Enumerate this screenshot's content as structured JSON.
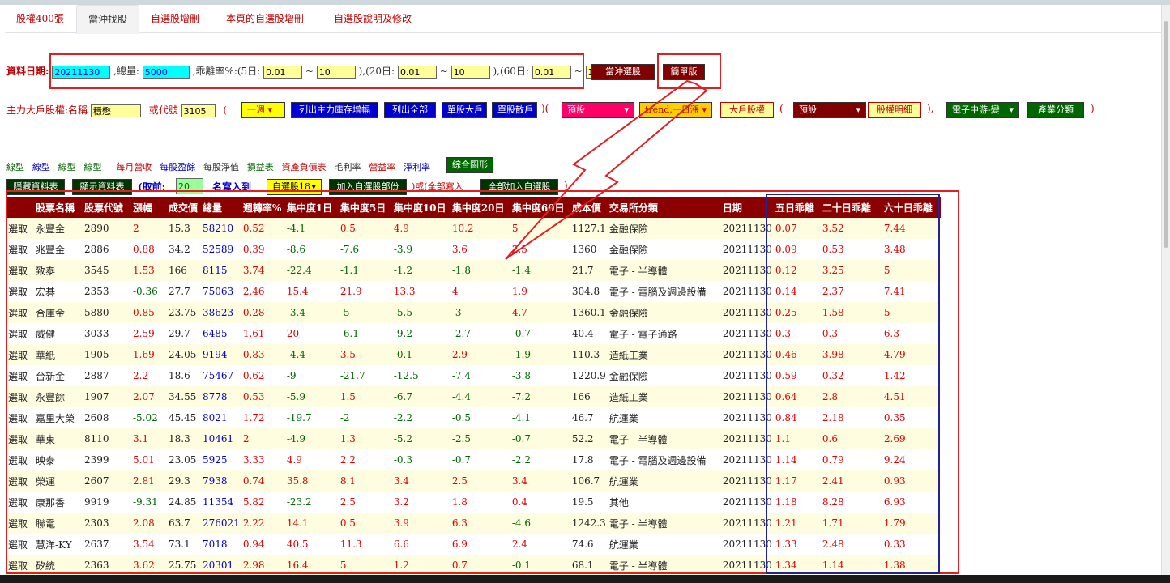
{
  "tabs": [
    "股權400張",
    "當沖找股",
    "自選股增刪",
    "本頁的自選股增刪",
    "自選股說明及修改"
  ],
  "active_tab": 1,
  "row1": {
    "date_label": "資料日期:",
    "date_value": "20211130",
    "total_label": ",總量:",
    "total_value": "5000",
    "dev_label": ",乖離率%:(5日:",
    "d5_min": "0.01",
    "d5_max": "10",
    "d20_label": "),(20日:",
    "d20_min": "0.01",
    "d20_max": "10",
    "d60_label": "),(60日:",
    "d60_min": "0.01",
    "d60_max": "10",
    "close": ")",
    "tilde": "~",
    "daytrade_btn": "當沖選股",
    "simple_btn": "簡單版"
  },
  "row2": {
    "label": "主力大戶股權:名稱",
    "name_value": "穩懋",
    "or_code": "或代號",
    "code_value": "3105",
    "paren_open": "(",
    "period_sel": "一週",
    "btn_list_stock": "列出主力庫存增幅",
    "btn_list_all": "列出全部",
    "btn_single_big": "單股大戶",
    "btn_single_scatter": "單股散戶",
    "paren_mid": ")(",
    "preset_sel": "預設",
    "trend_sel": "trend.一日漲",
    "btn_big_equity": "大戶股權",
    "paren_mid2": "(",
    "preset_sel2": "預設",
    "btn_equity_detail": "股權明細",
    "paren_close": "),",
    "industry_sel": "電子中游-變",
    "btn_industry": "產業分類",
    "paren_end": ")"
  },
  "links": {
    "items": [
      {
        "text": "線型",
        "color": "#006600"
      },
      {
        "text": "線型",
        "color": "#0000cc"
      },
      {
        "text": "線型",
        "color": "#006600"
      },
      {
        "text": "線型",
        "color": "#006600"
      },
      {
        "text": "每月營收",
        "color": "#c00000"
      },
      {
        "text": "每股盈餘",
        "color": "#0000cc"
      },
      {
        "text": "每股淨值",
        "color": "#333333"
      },
      {
        "text": "損益表",
        "color": "#006600"
      },
      {
        "text": "資產負債表",
        "color": "#c00000"
      },
      {
        "text": "毛利率",
        "color": "#333333"
      },
      {
        "text": "營益率",
        "color": "#c00000"
      },
      {
        "text": "淨利率",
        "color": "#0000cc"
      }
    ],
    "combo_btn": "綜合圖形"
  },
  "row4": {
    "hide_btn": "隱藏資料表",
    "show_btn": "顯示資料表",
    "take_label": "(取前:",
    "take_value": "20",
    "write_to": "名寫入到",
    "watchlist_sel": "自選股18",
    "add_part_btn": "加入自選股部份",
    "or_all": ")或(全部寫入",
    "add_all_btn": "全部加入自選股",
    "close": ")"
  },
  "table": {
    "headers": [
      "",
      "股票名稱",
      "股票代號",
      "漲幅",
      "成交價",
      "總量",
      "週轉率%",
      "集中度1日",
      "集中度5日",
      "集中度10日",
      "集中度20日",
      "集中度60日",
      "成本價",
      "交易所分類",
      "日期",
      "五日乖離",
      "二十日乖離",
      "六十日乖離"
    ],
    "select_label": "選取",
    "rows": [
      [
        "永豐金",
        "2890",
        "2",
        "15.3",
        "58210",
        "0.52",
        "-4.1",
        "0.5",
        "4.9",
        "10.2",
        "5",
        "1127.1",
        "金融保險",
        "20211130",
        "0.07",
        "3.52",
        "7.44"
      ],
      [
        "兆豐金",
        "2886",
        "0.88",
        "34.2",
        "52589",
        "0.39",
        "-8.6",
        "-7.6",
        "-3.9",
        "3.6",
        "2.5",
        "1360",
        "金融保險",
        "20211130",
        "0.09",
        "0.53",
        "3.48"
      ],
      [
        "致泰",
        "3545",
        "1.53",
        "166",
        "8115",
        "3.74",
        "-22.4",
        "-1.1",
        "-1.2",
        "-1.8",
        "-1.4",
        "21.7",
        "電子 - 半導體",
        "20211130",
        "0.12",
        "3.25",
        "5"
      ],
      [
        "宏碁",
        "2353",
        "-0.36",
        "27.7",
        "75063",
        "2.46",
        "15.4",
        "21.9",
        "13.3",
        "4",
        "1.9",
        "304.8",
        "電子 - 電腦及週邊設備",
        "20211130",
        "0.14",
        "2.37",
        "7.41"
      ],
      [
        "合庫金",
        "5880",
        "0.85",
        "23.75",
        "38623",
        "0.28",
        "-3.4",
        "-5",
        "-5.5",
        "-3",
        "4.7",
        "1360.1",
        "金融保險",
        "20211130",
        "0.25",
        "1.58",
        "5"
      ],
      [
        "威健",
        "3033",
        "2.59",
        "29.7",
        "6485",
        "1.61",
        "20",
        "-6.1",
        "-9.2",
        "-2.7",
        "-0.7",
        "40.4",
        "電子 - 電子通路",
        "20211130",
        "0.3",
        "0.3",
        "6.3"
      ],
      [
        "華紙",
        "1905",
        "1.69",
        "24.05",
        "9194",
        "0.83",
        "-4.4",
        "3.5",
        "-0.1",
        "2.9",
        "-1.9",
        "110.3",
        "造紙工業",
        "20211130",
        "0.46",
        "3.98",
        "4.79"
      ],
      [
        "台新金",
        "2887",
        "2.2",
        "18.6",
        "75467",
        "0.62",
        "-9",
        "-21.7",
        "-12.5",
        "-7.4",
        "-3.8",
        "1220.9",
        "金融保險",
        "20211130",
        "0.59",
        "0.32",
        "1.42"
      ],
      [
        "永豐餘",
        "1907",
        "2.07",
        "34.55",
        "8778",
        "0.53",
        "-5.9",
        "1.5",
        "-6.7",
        "-4.4",
        "-7.2",
        "166",
        "造紙工業",
        "20211130",
        "0.64",
        "2.8",
        "4.51"
      ],
      [
        "嘉里大榮",
        "2608",
        "-5.02",
        "45.45",
        "8021",
        "1.72",
        "-19.7",
        "-2",
        "-2.2",
        "-0.5",
        "-4.1",
        "46.7",
        "航運業",
        "20211130",
        "0.84",
        "2.18",
        "0.35"
      ],
      [
        "華東",
        "8110",
        "3.1",
        "18.3",
        "10461",
        "2",
        "-4.9",
        "1.3",
        "-5.2",
        "-2.5",
        "-0.7",
        "52.2",
        "電子 - 半導體",
        "20211130",
        "1.1",
        "0.6",
        "2.69"
      ],
      [
        "映泰",
        "2399",
        "5.01",
        "23.05",
        "5925",
        "3.33",
        "4.9",
        "2.2",
        "-0.3",
        "-0.7",
        "-2.2",
        "17.8",
        "電子 - 電腦及週邊設備",
        "20211130",
        "1.14",
        "0.79",
        "9.24"
      ],
      [
        "榮運",
        "2607",
        "2.81",
        "29.3",
        "7938",
        "0.74",
        "35.8",
        "8.1",
        "3.4",
        "2.5",
        "3.4",
        "106.7",
        "航運業",
        "20211130",
        "1.17",
        "2.41",
        "0.93"
      ],
      [
        "康那香",
        "9919",
        "-9.31",
        "24.85",
        "11354",
        "5.82",
        "-23.2",
        "2.5",
        "3.2",
        "1.8",
        "0.4",
        "19.5",
        "其他",
        "20211130",
        "1.18",
        "8.28",
        "6.93"
      ],
      [
        "聯電",
        "2303",
        "2.08",
        "63.7",
        "276021",
        "2.22",
        "14.1",
        "0.5",
        "3.9",
        "6.3",
        "-4.6",
        "1242.3",
        "電子 - 半導體",
        "20211130",
        "1.21",
        "1.71",
        "1.79"
      ],
      [
        "慧洋-KY",
        "2637",
        "3.54",
        "73.1",
        "7018",
        "0.94",
        "40.5",
        "11.3",
        "6.6",
        "6.9",
        "2.4",
        "74.6",
        "航運業",
        "20211130",
        "1.33",
        "2.48",
        "0.33"
      ],
      [
        "矽統",
        "2363",
        "3.62",
        "25.75",
        "20301",
        "2.98",
        "16.4",
        "5",
        "1.2",
        "0.7",
        "-0.1",
        "68.1",
        "電子 - 半導體",
        "20211130",
        "1.34",
        "1.14",
        "1.38"
      ]
    ]
  },
  "colors": {
    "header_bg": "#8b0000",
    "odd_row": "#fffde0",
    "positive": "#e00000",
    "negative": "#006600",
    "volume": "#0000cc",
    "annotation_red": "#e02020",
    "annotation_blue": "#2020a0"
  }
}
